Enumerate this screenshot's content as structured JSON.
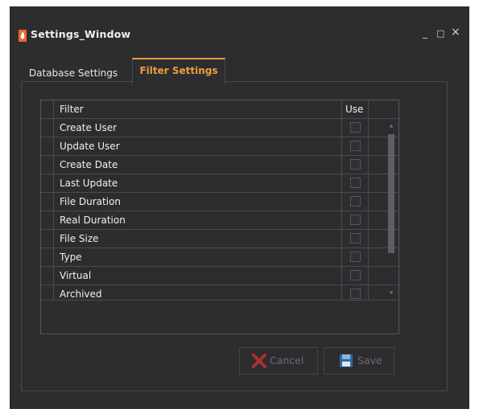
{
  "window": {
    "title": "Settings_Window",
    "minimize": "_",
    "maximize": "□",
    "close": "×"
  },
  "tabs": [
    {
      "label": "Database Settings",
      "active": false
    },
    {
      "label": "Filter Settings",
      "active": true
    }
  ],
  "grid": {
    "columns": [
      "Filter",
      "Use"
    ],
    "rows": [
      {
        "filter": "Create User",
        "use": false
      },
      {
        "filter": "Update User",
        "use": false
      },
      {
        "filter": "Create Date",
        "use": false
      },
      {
        "filter": "Last Update",
        "use": false
      },
      {
        "filter": "File Duration",
        "use": false
      },
      {
        "filter": "Real Duration",
        "use": false
      },
      {
        "filter": "File Size",
        "use": false
      },
      {
        "filter": "Type",
        "use": false
      },
      {
        "filter": "Virtual",
        "use": false
      },
      {
        "filter": "Archived",
        "use": false
      }
    ]
  },
  "buttons": {
    "cancel": "Cancel",
    "save": "Save"
  },
  "colors": {
    "background": "#2d2d30",
    "accent": "#e9a13a",
    "text": "#f0f0f0",
    "disabled_text": "#6b6b70"
  },
  "icons": {
    "app": "flame-icon",
    "cancel": "red-x-icon",
    "save": "floppy-disk-icon"
  }
}
